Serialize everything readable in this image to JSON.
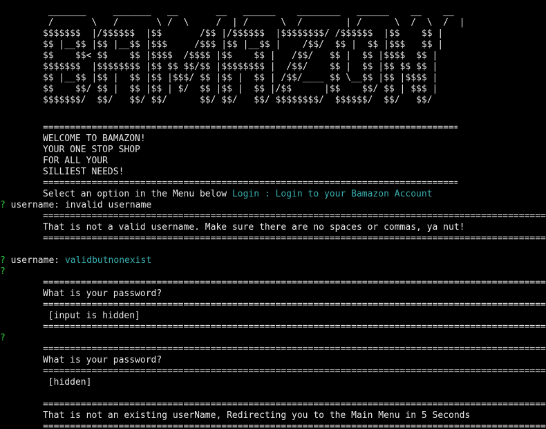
{
  "ascii_banner": [
    " _______     _______   __       __   ______    ________   ______    __    __",
    " /       \\   /       \\ /  \\     /  | /      \\  /        | /      \\  /  \\  /  |",
    "$$$$$$$  |/$$$$$$  |$$       /$$ |/$$$$$$  |$$$$$$$$/ /$$$$$$  |$$    $$ |",
    "$$ |__$$ |$$ |__$$ |$$$     /$$$ |$$ |__$$ |    /$$/  $$ |  $$ |$$$   $$ |",
    "$$    $$< $$    $$ |$$$$  /$$$$ |$$    $$ |   /$$/   $$ |  $$ |$$$$  $$ |",
    "$$$$$$$  |$$$$$$$$ |$$ $$ $$/$$ |$$$$$$$$ |  /$$/    $$ |  $$ |$$ $$ $$ |",
    "$$ |__$$ |$$ |  $$ |$$ |$$$/ $$ |$$ |  $$ | /$$/____ $$ \\__$$ |$$ |$$$$ |",
    "$$    $$/ $$ |  $$ |$$ | $/  $$ |$$ |  $$ |/$$      |$$    $$/ $$ | $$$ |",
    "$$$$$$$/  $$/   $$/ $$/      $$/ $$/   $$/ $$$$$$$$/  $$$$$$/  $$/   $$/"
  ],
  "separator_short": "=================================================================================================",
  "separator_long": "========================================================================================================================",
  "welcome": {
    "line1": "WELCOME TO BAMAZON!",
    "line2": "YOUR ONE STOP SHOP",
    "line3": "FOR ALL YOUR",
    "line4": "SILLIEST NEEDS!"
  },
  "menu": {
    "prompt": "Select an option in the Menu below",
    "selected": "Login : Login to your Bamazon Account"
  },
  "prompt_marker": "?",
  "username_attempt_1": {
    "label": "username:",
    "value": "invalid username",
    "error": "That is not a valid username. Make sure there are no spaces or commas, ya nut!"
  },
  "username_attempt_2": {
    "label": "username:",
    "value": "validbutnonexist"
  },
  "password_prompt_1": {
    "question": "What is your password?",
    "placeholder": "[input is hidden]"
  },
  "password_prompt_2": {
    "question": "What is your password?",
    "placeholder": "[hidden]"
  },
  "final_message": "That is not an existing userName, Redirecting you to the Main Menu in 5 Seconds",
  "colors": {
    "background": "#000000",
    "text": "#e8e8e8",
    "prompt_marker": "#2ecc40",
    "answer": "#37b0b0"
  }
}
